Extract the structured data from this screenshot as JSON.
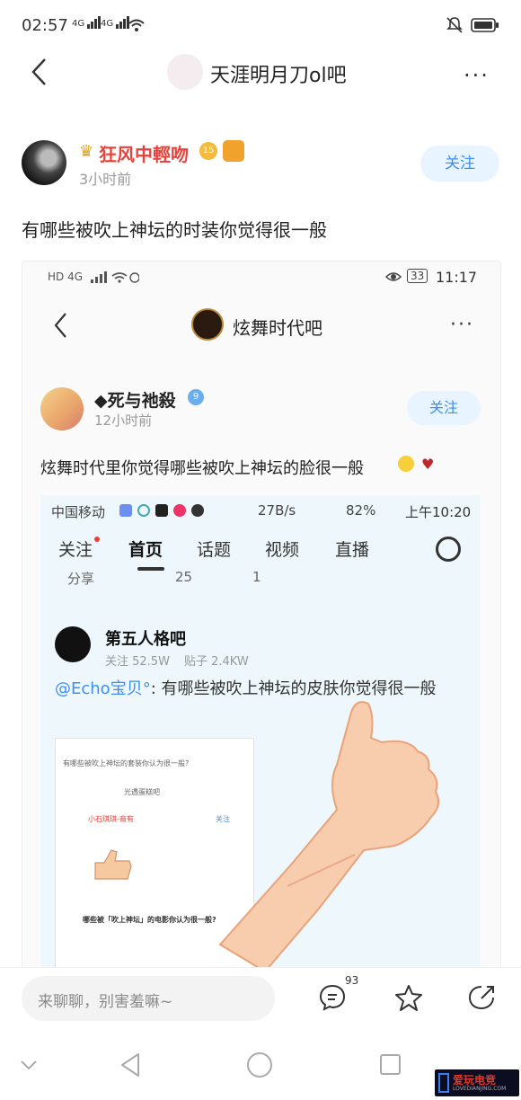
{
  "status_bar": {
    "time": "02:57",
    "signal_labels": [
      "4G",
      "4G"
    ]
  },
  "nav": {
    "forum_title": "天涯明月刀ol吧",
    "more": "···"
  },
  "post": {
    "author": "狂风中輕吻",
    "level": "15",
    "time": "3小时前",
    "follow": "关注",
    "title": "有哪些被吹上神坛的时装你觉得很一般"
  },
  "screenshot1": {
    "status_time": "11:17",
    "status_right": "33",
    "status_left": "HD 4G",
    "forum_title": "炫舞时代吧",
    "more": "···",
    "author": "◆死与祂殺",
    "badge": "9",
    "time": "12小时前",
    "follow": "关注",
    "title": "炫舞时代里你觉得哪些被吹上神坛的脸很一般"
  },
  "screenshot2": {
    "carrier": "中国移动",
    "speed": "27B/s",
    "battery": "82%",
    "time": "上午10:20",
    "tabs": [
      "关注",
      "首页",
      "话题",
      "视频",
      "直播"
    ],
    "stats": [
      "分享",
      "25",
      "1"
    ],
    "forum": "第五人格吧",
    "forum_followers": "关注 52.5W",
    "forum_posts": "贴子 2.4KW",
    "mention": "@Echo宝贝°",
    "text": ": 有哪些被吹上神坛的皮肤你觉得很一般",
    "mini_title": "有哪些被吹上神坛的套装你认为很一般?",
    "mini_forum": "光遇蛋糕吧",
    "mini_user": "小石琪琪-商有",
    "mini_q": "哪些被「吹上神坛」的电影你认为很一般?",
    "mini_follow": "关注"
  },
  "bottom": {
    "placeholder": "来聊聊，别害羞嘛~",
    "comment_count": "93"
  },
  "watermark": {
    "title": "爱玩电竞",
    "sub": "LOVEDIANJING.COM"
  },
  "colors": {
    "accent": "#3a8ff0",
    "username": "#e8413a",
    "follow_bg": "#e8f4ff"
  }
}
